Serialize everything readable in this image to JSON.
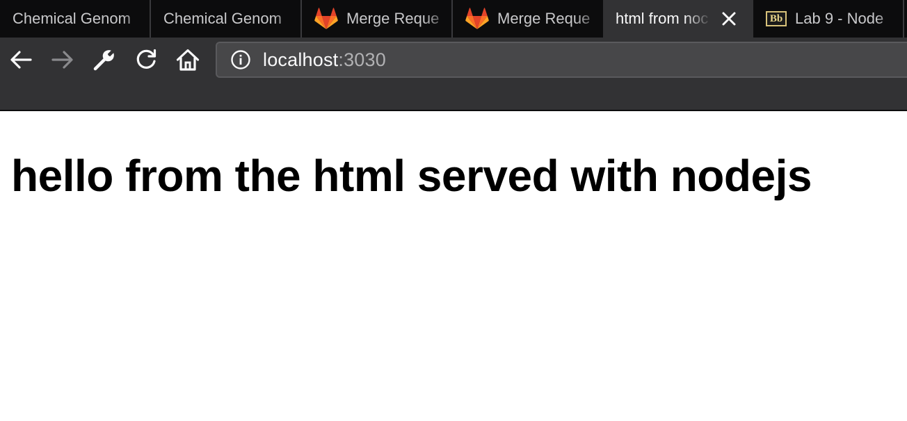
{
  "tabs": [
    {
      "title": "Chemical Genom",
      "favicon": "none",
      "active": false
    },
    {
      "title": "Chemical Genom",
      "favicon": "none",
      "active": false
    },
    {
      "title": "Merge Reque",
      "favicon": "gitlab-icon",
      "active": false
    },
    {
      "title": "Merge Reque",
      "favicon": "gitlab-icon",
      "active": false
    },
    {
      "title": "html from noc",
      "favicon": "none",
      "active": true,
      "close_icon": "close-icon"
    },
    {
      "title": "Lab 9 - Node",
      "favicon": "blackboard-icon",
      "favicon_text": "Bb",
      "active": false
    }
  ],
  "toolbar": {
    "back_icon": "back-arrow-icon",
    "forward_icon": "forward-arrow-icon",
    "tools_icon": "wrench-icon",
    "reload_icon": "reload-icon",
    "home_icon": "home-icon"
  },
  "urlbar": {
    "info_icon": "info-icon",
    "host": "localhost",
    "port": ":3030"
  },
  "page": {
    "heading": "hello from the html served with nodejs"
  },
  "colors": {
    "tabbar_bg": "#0c0c0d",
    "toolbar_bg": "#323234",
    "urlbar_bg": "#474749",
    "page_bg": "#ffffff",
    "heading_color": "#000000"
  }
}
